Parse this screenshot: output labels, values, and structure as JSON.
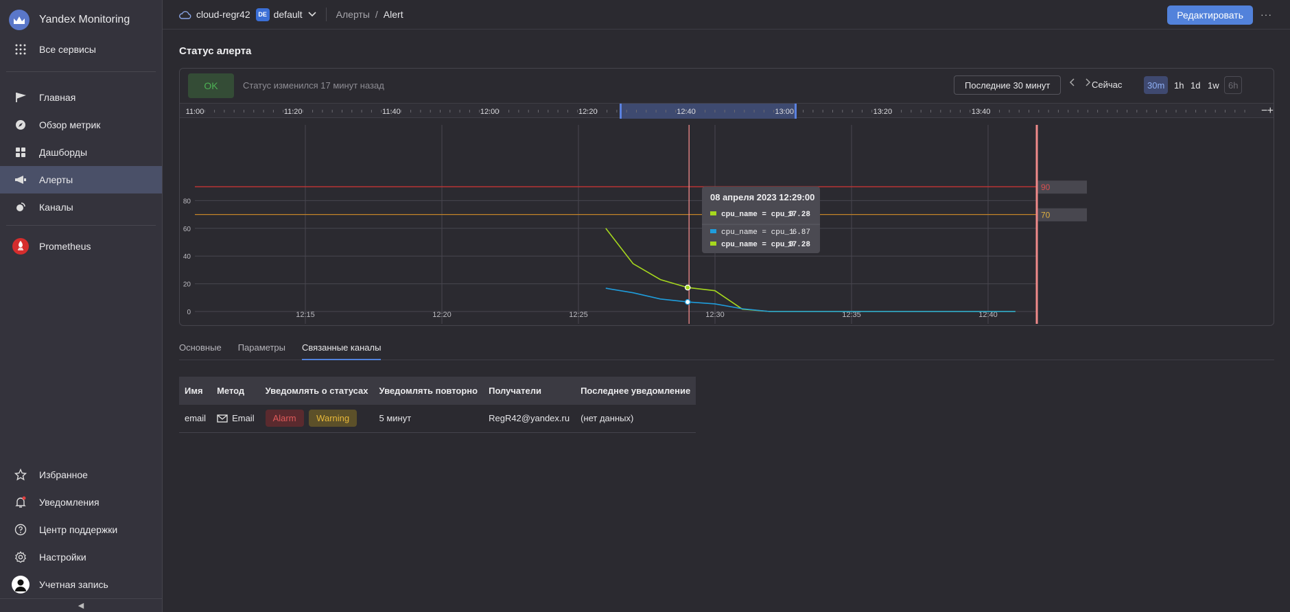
{
  "app": {
    "title": "Yandex Monitoring",
    "all_services": "Все сервисы"
  },
  "sidebar": {
    "items": [
      {
        "label": "Главная",
        "icon": "flag-icon"
      },
      {
        "label": "Обзор метрик",
        "icon": "compass-icon"
      },
      {
        "label": "Дашборды",
        "icon": "dashboard-icon"
      },
      {
        "label": "Алерты",
        "icon": "megaphone-icon",
        "active": true
      },
      {
        "label": "Каналы",
        "icon": "antenna-icon"
      }
    ],
    "prometheus": "Prometheus",
    "bottom": [
      {
        "label": "Избранное",
        "icon": "star-icon"
      },
      {
        "label": "Уведомления",
        "icon": "bell-icon"
      },
      {
        "label": "Центр поддержки",
        "icon": "help-icon"
      },
      {
        "label": "Настройки",
        "icon": "gear-icon"
      },
      {
        "label": "Учетная запись",
        "icon": "user-icon"
      }
    ]
  },
  "topbar": {
    "cloud": "cloud-regr42",
    "folder_badge": "DE",
    "folder": "default",
    "crumb_alerts": "Алерты",
    "crumb_sep": "/",
    "crumb_alert": "Alert",
    "edit_button": "Редактировать",
    "more": "···"
  },
  "status": {
    "section_title": "Статус алерта",
    "badge": "OK",
    "text": "Статус изменился 17 минут назад",
    "range": "Последние 30 минут",
    "now": "Сейчас",
    "scales": [
      "30m",
      "1h",
      "1d",
      "1w",
      "6h"
    ]
  },
  "timeline_labels": [
    "11:00",
    "11:20",
    "11:40",
    "12:00",
    "12:20",
    "12:40",
    "13:00",
    "13:20",
    "13:40"
  ],
  "chart_data": {
    "type": "line",
    "x": [
      "12:26",
      "12:27",
      "12:28",
      "12:29",
      "12:30",
      "12:31",
      "12:32",
      "12:33",
      "12:34",
      "12:35",
      "12:36",
      "12:37",
      "12:38",
      "12:39",
      "12:40",
      "12:41"
    ],
    "x_ticks": [
      "12:15",
      "12:20",
      "12:25",
      "12:30",
      "12:35",
      "12:40"
    ],
    "y_ticks": [
      0,
      20,
      40,
      60,
      80
    ],
    "ylim": [
      -5,
      95
    ],
    "series": [
      {
        "name": "cpu_name = cpu_0",
        "color": "#a6d81e",
        "values": [
          60,
          34.5,
          23,
          17.28,
          15,
          1.7,
          0,
          0,
          0,
          0,
          0,
          0,
          0,
          0,
          0,
          0
        ]
      },
      {
        "name": "cpu_name = cpu_1",
        "color": "#1f9ddc",
        "values": [
          16.8,
          13.5,
          9,
          6.87,
          5.5,
          2,
          0,
          0,
          0,
          0,
          0,
          0,
          0,
          0,
          0,
          0
        ]
      }
    ],
    "thresholds": [
      {
        "value": 90,
        "color": "#c53535",
        "label": "90"
      },
      {
        "value": 70,
        "color": "#c58428",
        "label": "70"
      }
    ],
    "tooltip": {
      "title": "08 апреля 2023 12:29:00",
      "rows": [
        {
          "label": "cpu_name = cpu_0",
          "value": "17.28",
          "color": "#a6d81e"
        },
        {
          "label": "cpu_name = cpu_1",
          "value": "6.87",
          "color": "#1f9ddc"
        },
        {
          "label": "cpu_name = cpu_0",
          "value": "17.28",
          "color": "#a6d81e"
        }
      ]
    }
  },
  "tabs": [
    "Основные",
    "Параметры",
    "Связанные каналы"
  ],
  "table": {
    "headers": [
      "Имя",
      "Метод",
      "Уведомлять о статусах",
      "Уведомлять повторно",
      "Получатели",
      "Последнее уведомление"
    ],
    "row": {
      "name": "email",
      "method": "Email",
      "status_alarm": "Alarm",
      "status_warning": "Warning",
      "repeat": "5 минут",
      "recipients": "RegR42@yandex.ru",
      "last": "(нет данных)"
    }
  },
  "collapse": "◀"
}
